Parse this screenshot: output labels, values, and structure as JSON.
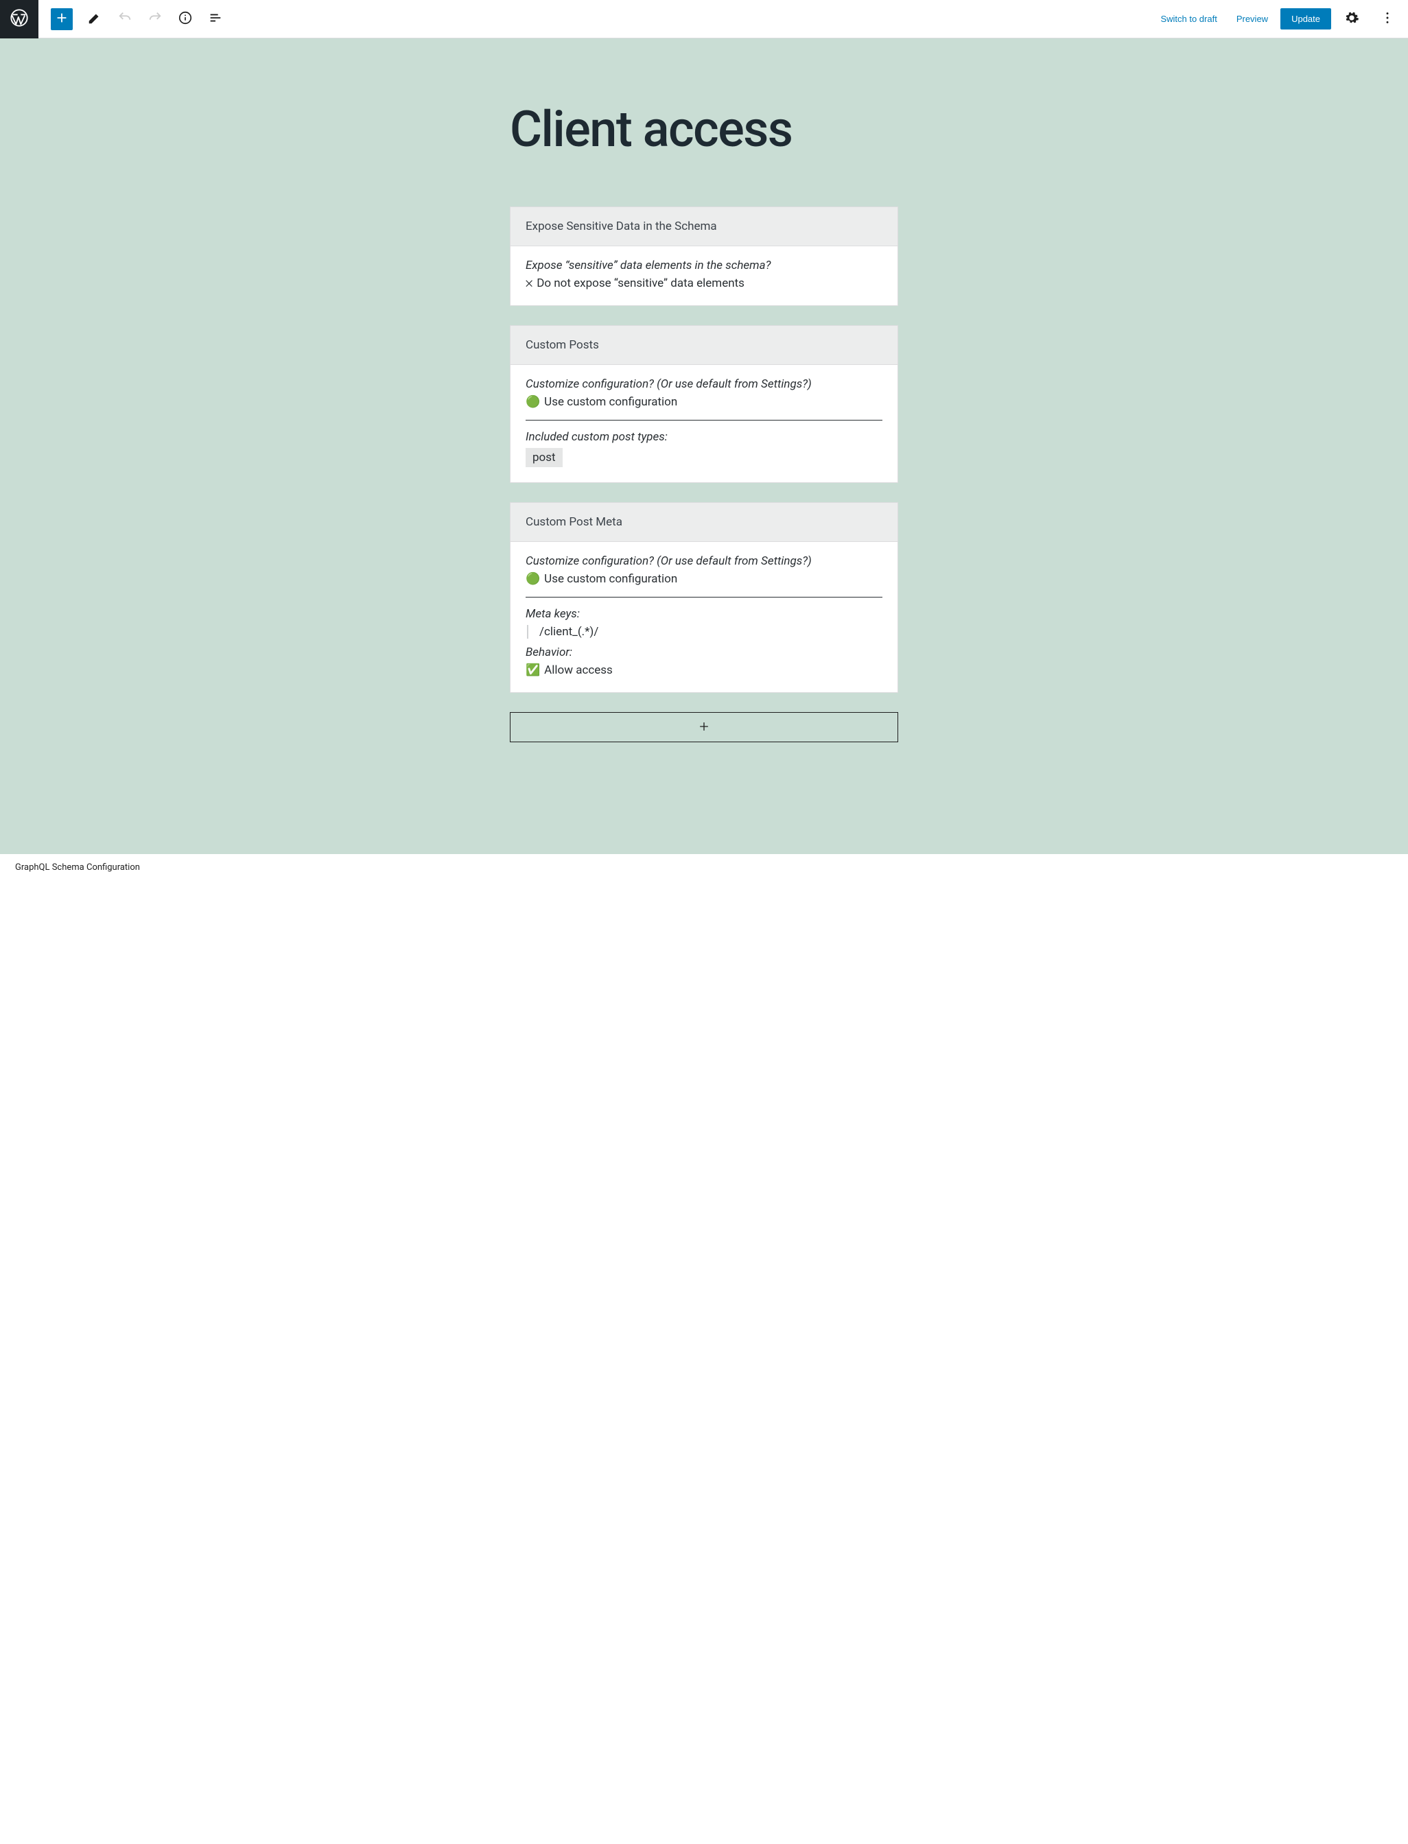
{
  "toolbar": {
    "switch_to_draft": "Switch to draft",
    "preview": "Preview",
    "update": "Update"
  },
  "page": {
    "title": "Client access"
  },
  "blocks": {
    "sensitive": {
      "title": "Expose Sensitive Data in the Schema",
      "question": "Expose “sensitive” data elements in the schema?",
      "answer_icon": "❌",
      "answer": "Do not expose “sensitive” data elements"
    },
    "custom_posts": {
      "title": "Custom Posts",
      "question": "Customize configuration? (Or use default from Settings?)",
      "answer_icon": "🟢",
      "answer": "Use custom configuration",
      "included_label": "Included custom post types:",
      "included": [
        "post"
      ]
    },
    "custom_post_meta": {
      "title": "Custom Post Meta",
      "question": "Customize configuration? (Or use default from Settings?)",
      "answer_icon": "🟢",
      "answer": "Use custom configuration",
      "meta_label": "Meta keys:",
      "meta_keys": [
        "/client_(.*)/"
      ],
      "behavior_label": "Behavior:",
      "behavior_icon": "✅",
      "behavior": "Allow access"
    }
  },
  "footer": "GraphQL Schema Configuration"
}
